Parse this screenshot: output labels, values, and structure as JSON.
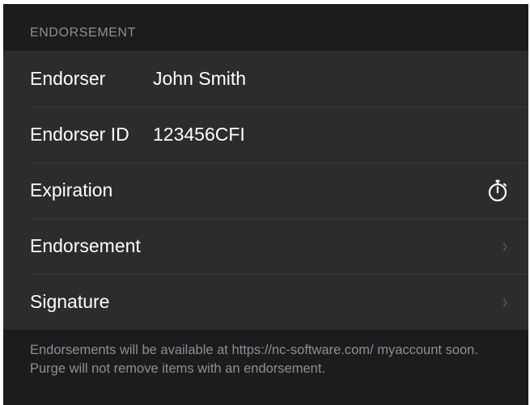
{
  "section": {
    "header": "ENDORSEMENT"
  },
  "rows": [
    {
      "label": "Endorser",
      "value": "John Smith"
    },
    {
      "label": "Endorser ID",
      "value": "123456CFI"
    },
    {
      "label": "Expiration",
      "icon": "stopwatch-icon"
    },
    {
      "label": "Endorsement",
      "icon": "chevron-right-icon"
    },
    {
      "label": "Signature",
      "icon": "chevron-right-icon"
    }
  ],
  "footer": {
    "note": "Endorsements will be available at https://nc-software.com/ myaccount soon. Purge will not remove items with an endorsement."
  },
  "colors": {
    "background": "#1c1c1e",
    "row_background": "#2c2c2e",
    "separator": "#3a3a3c",
    "secondary_text": "#8e8e93",
    "primary_text": "#ffffff"
  }
}
